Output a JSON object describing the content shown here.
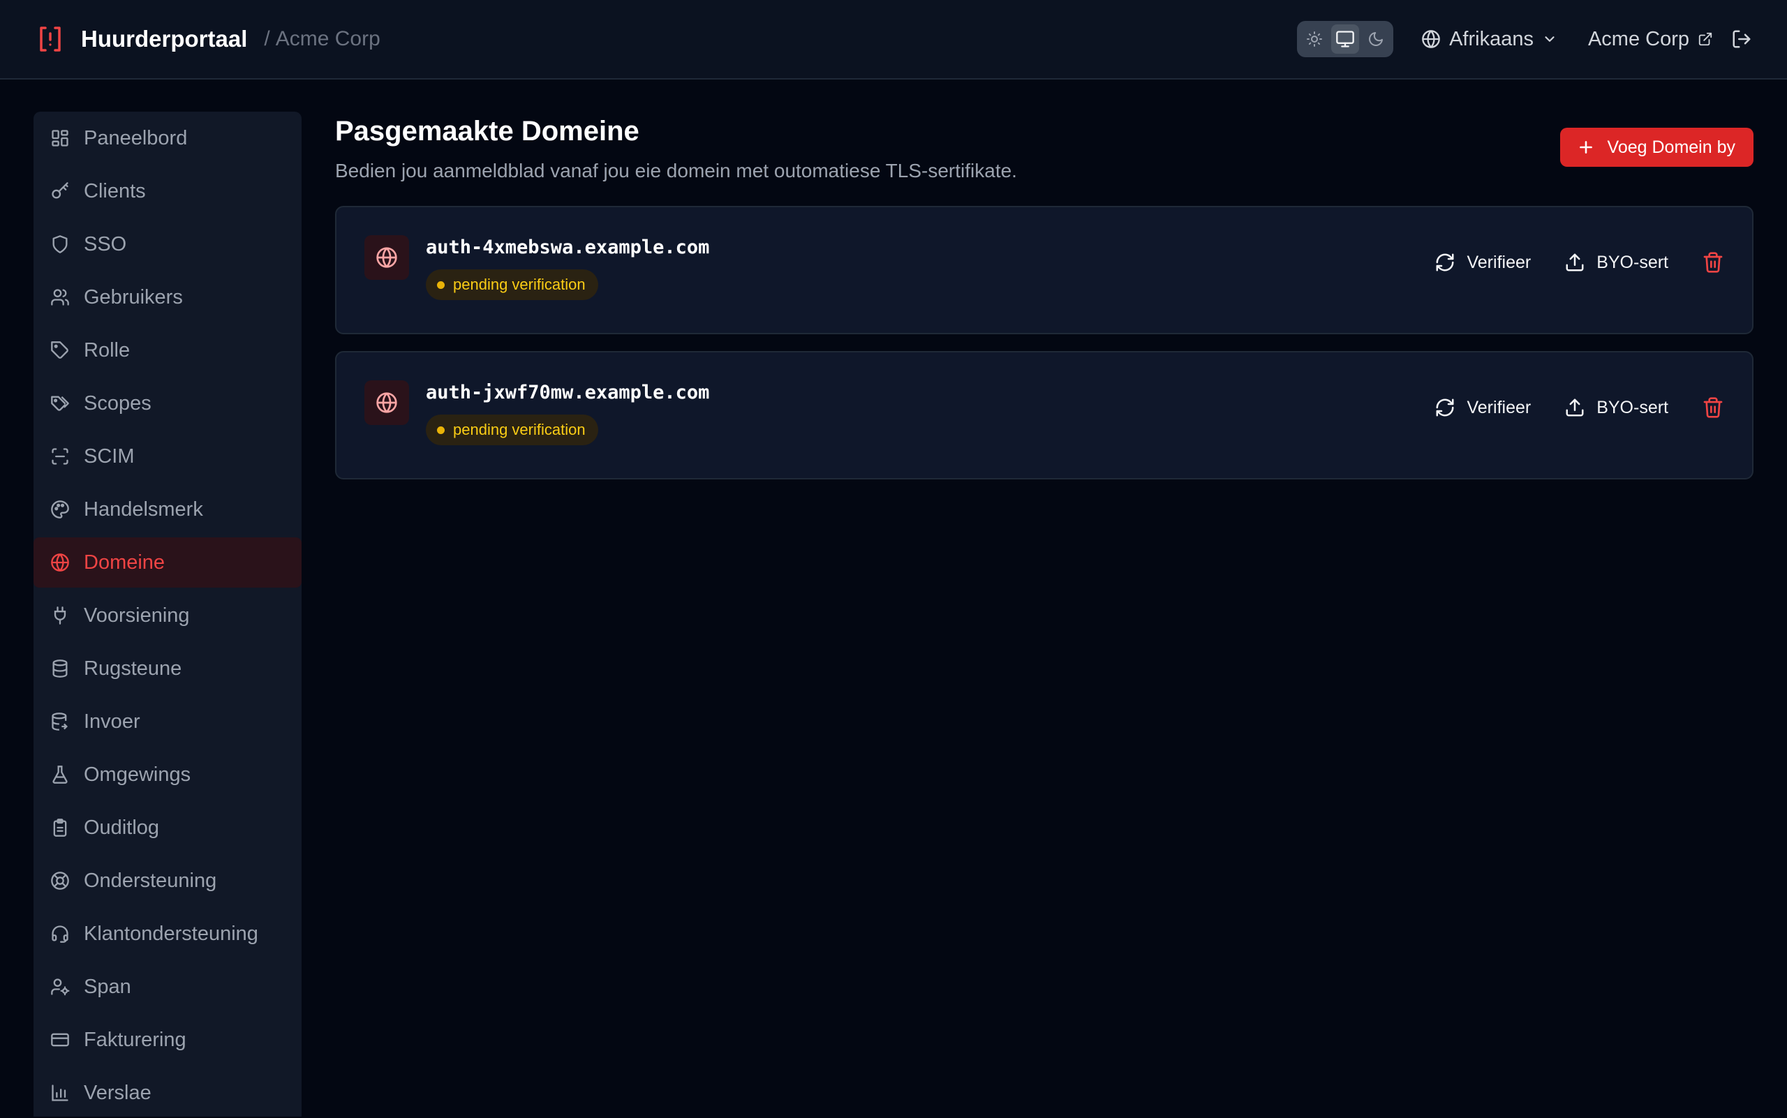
{
  "header": {
    "brand": "Huurderportaal",
    "separator": "/",
    "org": "Acme Corp",
    "language": "Afrikaans",
    "org_link": "Acme Corp"
  },
  "sidebar": {
    "items": [
      {
        "label": "Paneelbord",
        "icon": "dashboard-icon"
      },
      {
        "label": "Clients",
        "icon": "key-icon"
      },
      {
        "label": "SSO",
        "icon": "shield-icon"
      },
      {
        "label": "Gebruikers",
        "icon": "users-icon"
      },
      {
        "label": "Rolle",
        "icon": "tag-icon"
      },
      {
        "label": "Scopes",
        "icon": "tags-icon"
      },
      {
        "label": "SCIM",
        "icon": "scan-icon"
      },
      {
        "label": "Handelsmerk",
        "icon": "palette-icon"
      },
      {
        "label": "Domeine",
        "icon": "globe-icon",
        "active": true
      },
      {
        "label": "Voorsiening",
        "icon": "plug-icon"
      },
      {
        "label": "Rugsteune",
        "icon": "database-icon"
      },
      {
        "label": "Invoer",
        "icon": "database-import-icon"
      },
      {
        "label": "Omgewings",
        "icon": "flask-icon"
      },
      {
        "label": "Ouditlog",
        "icon": "clipboard-icon"
      },
      {
        "label": "Ondersteuning",
        "icon": "lifebuoy-icon"
      },
      {
        "label": "Klantondersteuning",
        "icon": "headset-icon"
      },
      {
        "label": "Span",
        "icon": "user-cog-icon"
      },
      {
        "label": "Fakturering",
        "icon": "credit-card-icon"
      },
      {
        "label": "Verslae",
        "icon": "bar-chart-icon"
      }
    ]
  },
  "main": {
    "title": "Pasgemaakte Domeine",
    "subtitle": "Bedien jou aanmeldblad vanaf jou eie domein met outomatiese TLS-sertifikate.",
    "add_button": "Voeg Domein by",
    "domains": [
      {
        "name": "auth-4xmebswa.example.com",
        "status": "pending verification",
        "verify": "Verifieer",
        "byo": "BYO-sert"
      },
      {
        "name": "auth-jxwf70mw.example.com",
        "status": "pending verification",
        "verify": "Verifieer",
        "byo": "BYO-sert"
      }
    ]
  },
  "colors": {
    "accent": "#dc2626",
    "active_nav": "#ef4444",
    "pending": "#facc15",
    "background": "#030712"
  }
}
